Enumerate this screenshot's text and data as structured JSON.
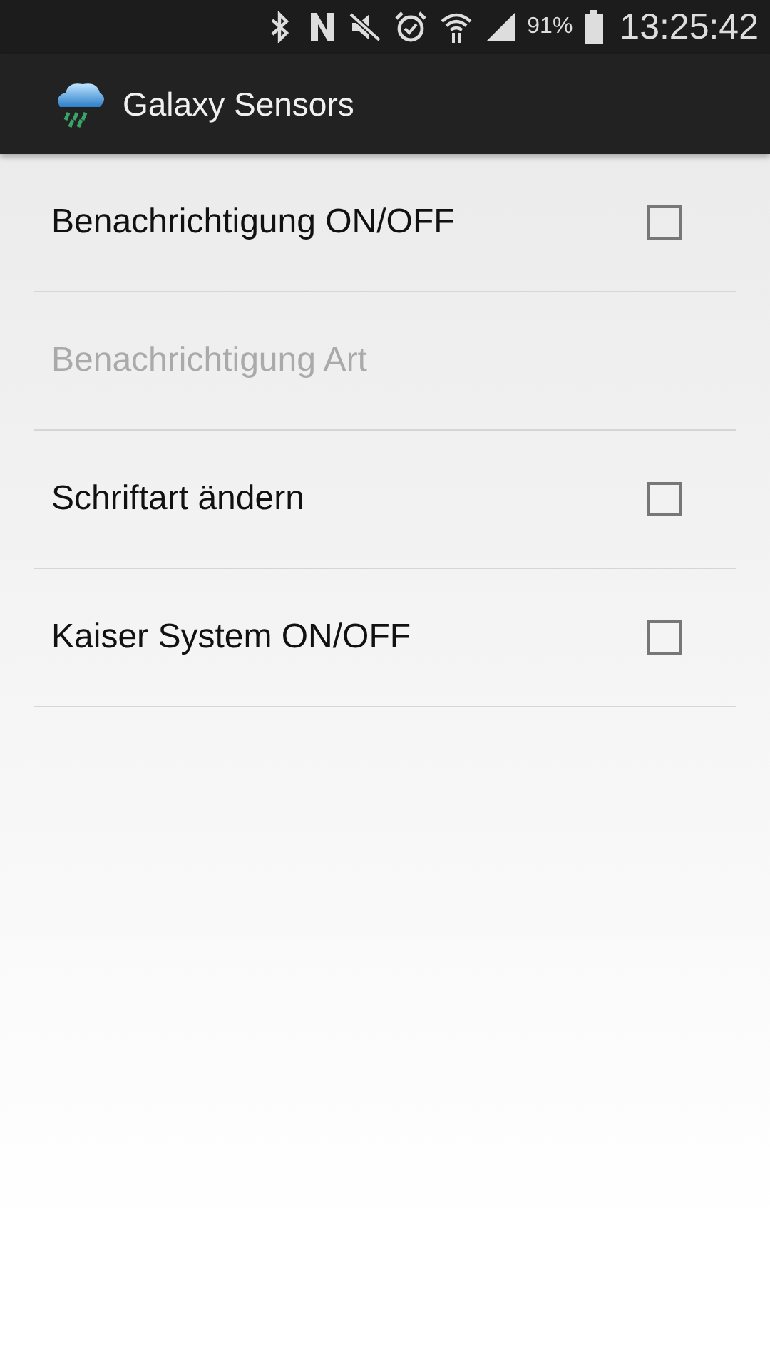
{
  "status_bar": {
    "battery": "91%",
    "time": "13:25:42"
  },
  "action_bar": {
    "title": "Galaxy Sensors"
  },
  "settings": [
    {
      "label": "Benachrichtigung ON/OFF",
      "kind": "checkbox",
      "checked": false,
      "disabled": false
    },
    {
      "label": "Benachrichtigung Art",
      "kind": "plain",
      "disabled": true
    },
    {
      "label": "Schriftart ändern",
      "kind": "checkbox",
      "checked": false,
      "disabled": false
    },
    {
      "label": "Kaiser System ON/OFF",
      "kind": "checkbox",
      "checked": false,
      "disabled": false
    }
  ]
}
